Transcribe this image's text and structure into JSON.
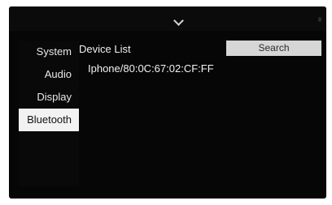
{
  "header": {
    "chevron_icon": "chevron-down-icon"
  },
  "sidebar": {
    "items": [
      {
        "label": "System",
        "active": false
      },
      {
        "label": "Audio",
        "active": false
      },
      {
        "label": "Display",
        "active": false
      },
      {
        "label": "Bluetooth",
        "active": true
      }
    ]
  },
  "main": {
    "title": "Device List",
    "search_label": "Search",
    "devices": [
      "Iphone/80:0C:67:02:CF:FF"
    ]
  },
  "colors": {
    "screen_background": "#060606",
    "active_tab_background": "#f2f2f2",
    "search_button_background": "#d6d6d6",
    "text": "#f0f0f0"
  }
}
